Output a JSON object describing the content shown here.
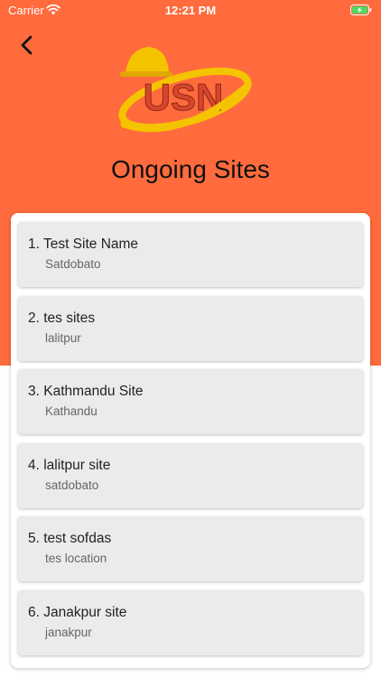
{
  "status_bar": {
    "carrier": "Carrier",
    "time": "12:21 PM"
  },
  "colors": {
    "header": "#ff6b3d",
    "logo_accent": "#f5c400",
    "logo_text": "#d9452b"
  },
  "logo": {
    "text": "USN"
  },
  "page": {
    "title": "Ongoing Sites"
  },
  "sites": [
    {
      "title": "1. Test Site Name",
      "location": "Satdobato"
    },
    {
      "title": "2. tes sites",
      "location": "lalitpur"
    },
    {
      "title": "3. Kathmandu Site",
      "location": "Kathandu"
    },
    {
      "title": "4. lalitpur site",
      "location": "satdobato"
    },
    {
      "title": "5. test sofdas",
      "location": "tes location"
    },
    {
      "title": "6. Janakpur site",
      "location": "janakpur"
    }
  ]
}
